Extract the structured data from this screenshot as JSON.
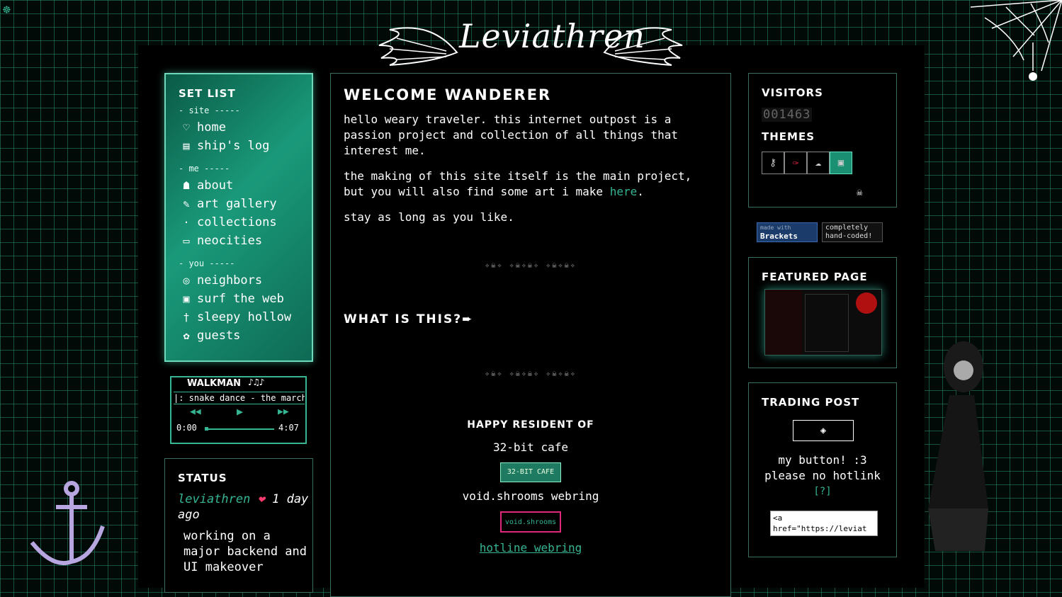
{
  "site": {
    "logo_text": "Leviathren"
  },
  "setlist": {
    "title": "SET LIST",
    "sections": [
      {
        "label": "- site -----",
        "items": [
          {
            "label": "home",
            "icon": "♡"
          },
          {
            "label": "ship's log",
            "icon": "▤"
          }
        ]
      },
      {
        "label": "- me -----",
        "items": [
          {
            "label": "about",
            "icon": "☗"
          },
          {
            "label": "art gallery",
            "icon": "✎"
          },
          {
            "label": "collections",
            "icon": "·"
          },
          {
            "label": "neocities",
            "icon": "▭"
          }
        ]
      },
      {
        "label": "- you -----",
        "items": [
          {
            "label": "neighbors",
            "icon": "◎"
          },
          {
            "label": "surf the web",
            "icon": "▣"
          },
          {
            "label": "sleepy hollow",
            "icon": "†"
          },
          {
            "label": "guests",
            "icon": "✿"
          }
        ]
      }
    ]
  },
  "walkman": {
    "title": "WALKMAN",
    "song": "|: snake dance - the march",
    "time_current": "0:00",
    "time_total": "4:07",
    "progress": 0
  },
  "status": {
    "title": "STATUS",
    "user": "leviathren",
    "heart": "❤",
    "ago": "1 day ago",
    "message": "working on a major backend and UI makeover"
  },
  "main": {
    "title": "WELCOME  WANDERER",
    "p1": "hello weary traveler. this internet outpost is a passion project and collection of all things that interest me.",
    "p2_prefix": "the making of this site itself is the main project, but you will also find some art i make ",
    "p2_link": "here",
    "p2_suffix": ".",
    "p3": "stay as long as you like.",
    "divider": "✧☠✧ ✧☠✧☠✧ ✧☠✧☠✧",
    "whatis": "WHAT IS THIS?➨",
    "resident_title": "HAPPY RESIDENT OF",
    "cafe": "32-bit cafe",
    "cafe_button": "32-BIT CAFE",
    "webring1": "void.shrooms webring",
    "webring1_button": "void.shrooms",
    "webring2": "hotline webring"
  },
  "visitors": {
    "title": "VISITORS",
    "count": "001463",
    "themes_title": "THEMES",
    "themes": [
      "key-icon",
      "syringe-icon",
      "brain-icon",
      "computer-icon"
    ],
    "theme_glyphs": [
      "⚷",
      "✑",
      "☁",
      "▣"
    ]
  },
  "badges": {
    "brackets_small": "made with",
    "brackets": "Brackets",
    "handcoded": "completely hand-coded!"
  },
  "featured": {
    "title": "FEATURED PAGE"
  },
  "trading": {
    "title": "TRADING POST",
    "button_glyph": "◈",
    "line1": "my button! :3",
    "line2": "please no hotlink",
    "help": "[?]",
    "code": "<a href=\"https://leviat"
  },
  "colors": {
    "accent": "#35b594",
    "grid": "#288c6e",
    "panel_green": "#1a9a7a"
  }
}
